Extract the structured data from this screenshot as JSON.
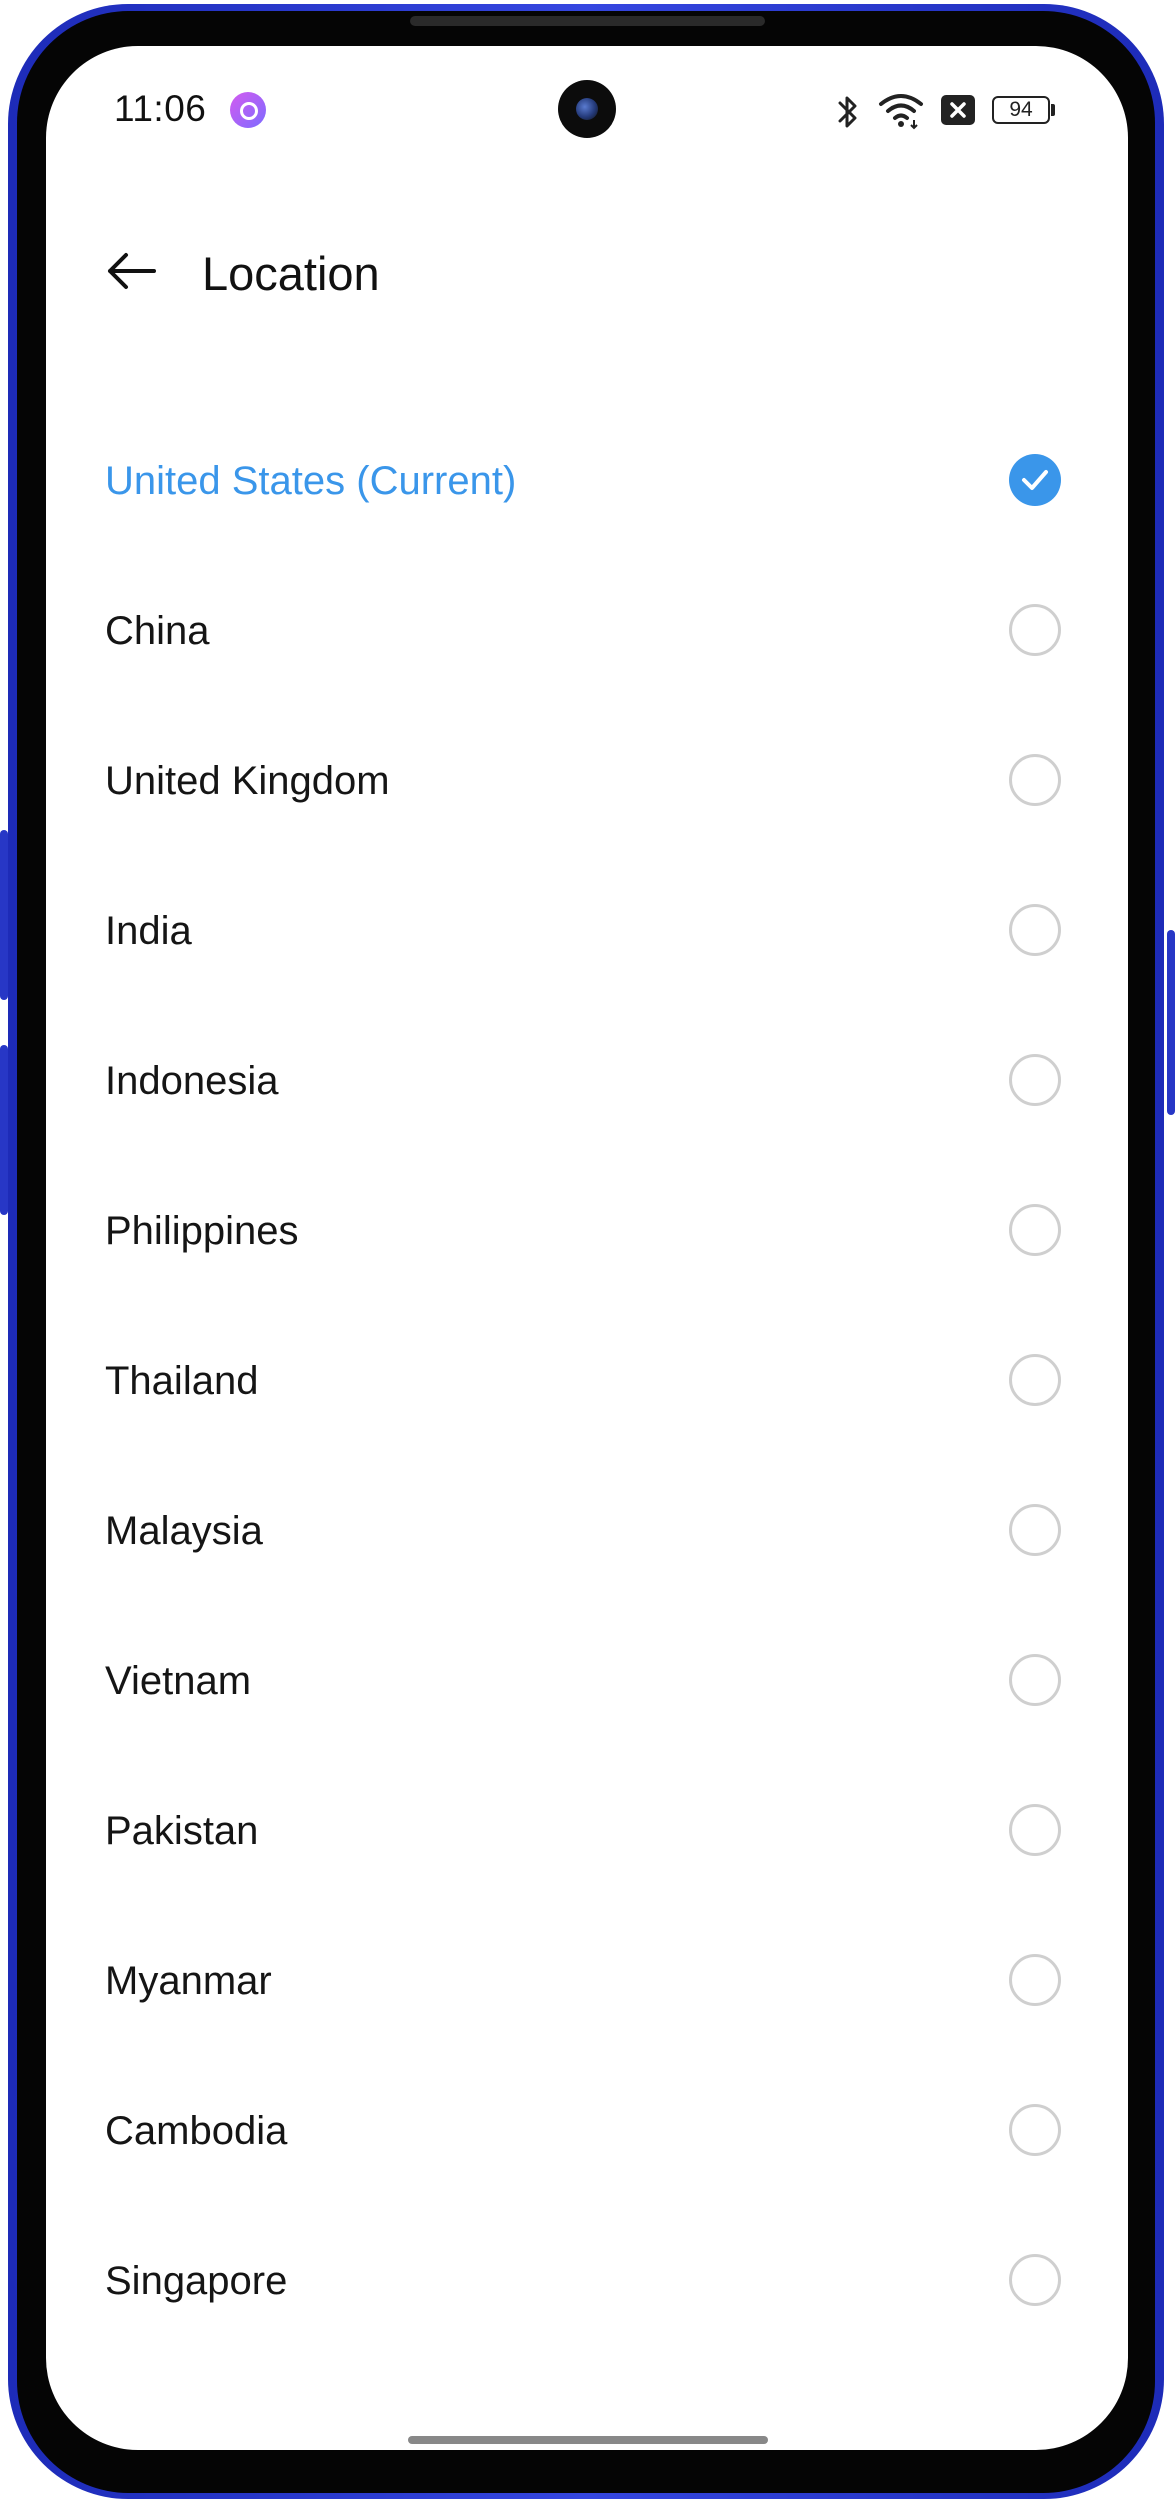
{
  "status_bar": {
    "time": "11:06",
    "battery": "94",
    "icons": [
      "app-notification-icon",
      "bluetooth-icon",
      "wifi-icon",
      "sim-none-icon",
      "battery-icon"
    ]
  },
  "header": {
    "title": "Location",
    "back_icon": "arrow-left-icon"
  },
  "colors": {
    "accent": "#3a96ea",
    "text": "#151515",
    "radio_border": "#cfcfcf",
    "frame": "#2737c6"
  },
  "locations": [
    {
      "label": "United States (Current)",
      "selected": true
    },
    {
      "label": "China",
      "selected": false
    },
    {
      "label": "United Kingdom",
      "selected": false
    },
    {
      "label": "India",
      "selected": false
    },
    {
      "label": "Indonesia",
      "selected": false
    },
    {
      "label": "Philippines",
      "selected": false
    },
    {
      "label": "Thailand",
      "selected": false
    },
    {
      "label": "Malaysia",
      "selected": false
    },
    {
      "label": "Vietnam",
      "selected": false
    },
    {
      "label": "Pakistan",
      "selected": false
    },
    {
      "label": "Myanmar",
      "selected": false
    },
    {
      "label": "Cambodia",
      "selected": false
    },
    {
      "label": "Singapore",
      "selected": false
    }
  ]
}
